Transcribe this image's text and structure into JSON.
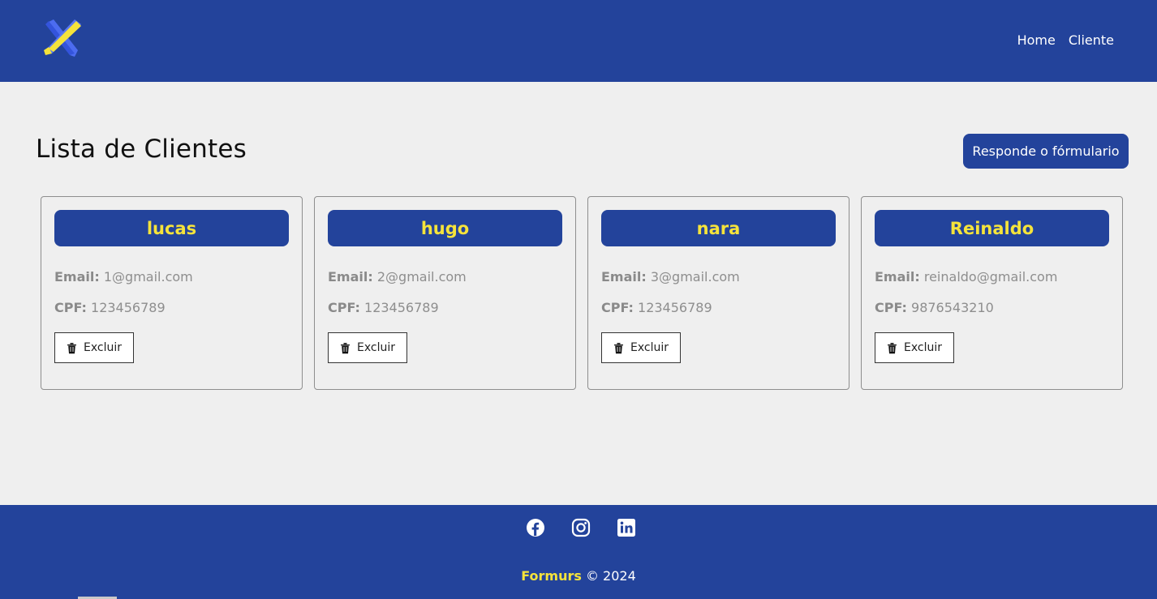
{
  "header": {
    "nav": [
      "Home",
      "Cliente"
    ]
  },
  "main": {
    "title": "Lista de Clientes",
    "form_button": "Responde o fórmulario",
    "email_label": "Email:",
    "cpf_label": "CPF:",
    "delete_label": "Excluir",
    "clients": [
      {
        "name": "lucas",
        "email": "1@gmail.com",
        "cpf": "123456789"
      },
      {
        "name": "hugo",
        "email": "2@gmail.com",
        "cpf": "123456789"
      },
      {
        "name": "nara",
        "email": "3@gmail.com",
        "cpf": "123456789"
      },
      {
        "name": "Reinaldo",
        "email": "reinaldo@gmail.com",
        "cpf": "9876543210"
      }
    ]
  },
  "footer": {
    "brand": "Formurs",
    "copyright": " © 2024",
    "social_icons": [
      "facebook-icon",
      "instagram-icon",
      "linkedin-icon"
    ]
  },
  "colors": {
    "primary": "#23439b",
    "accent": "#f5e33b",
    "background": "#efefef"
  }
}
